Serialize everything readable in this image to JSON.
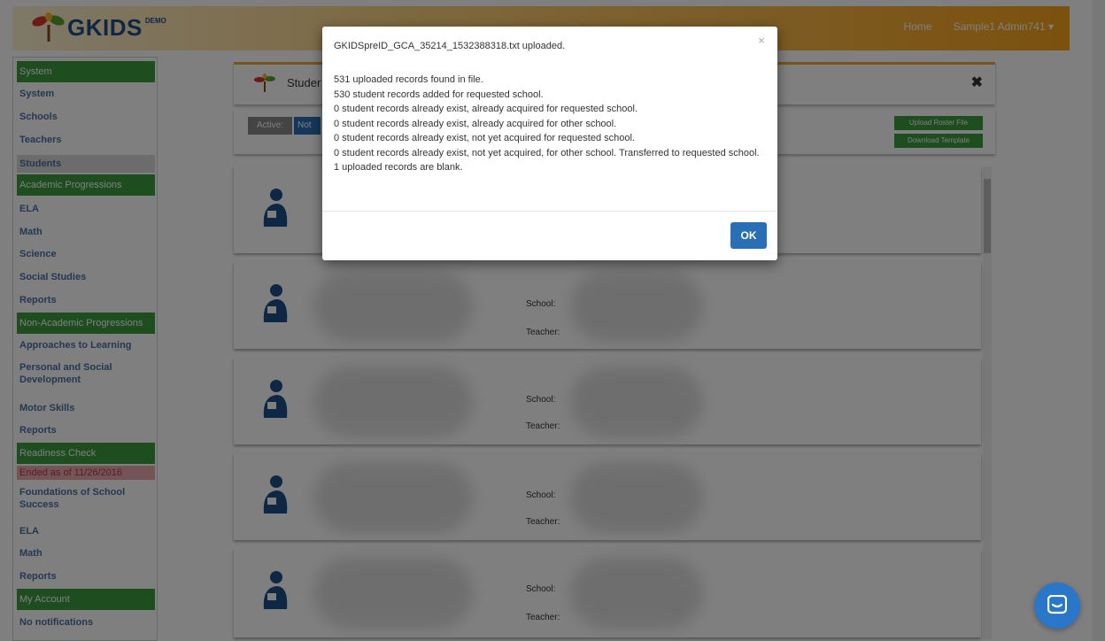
{
  "brand": {
    "name": "GKIDS",
    "badge": "DEMO"
  },
  "nav": {
    "home": "Home",
    "user_menu": "Sample1 Admin741 ▾"
  },
  "sidebar": {
    "items": [
      {
        "label": "System",
        "type": "head"
      },
      {
        "label": "System"
      },
      {
        "label": "Schools"
      },
      {
        "label": "Teachers"
      },
      {
        "label": "Students",
        "active": true
      },
      {
        "label": "Academic Progressions",
        "type": "head"
      },
      {
        "label": "ELA"
      },
      {
        "label": "Math"
      },
      {
        "label": "Science"
      },
      {
        "label": "Social Studies"
      },
      {
        "label": "Reports"
      },
      {
        "label": "Non-Academic Progressions",
        "type": "head"
      },
      {
        "label": "Approaches to Learning"
      },
      {
        "label": "Personal and Social Development"
      },
      {
        "label": "Motor Skills"
      },
      {
        "label": "Reports"
      },
      {
        "label": "Readiness Check",
        "type": "head"
      },
      {
        "label": "Ended as of 11/26/2016",
        "type": "ended"
      },
      {
        "label": "Foundations of School Success"
      },
      {
        "label": "ELA"
      },
      {
        "label": "Math"
      },
      {
        "label": "Reports"
      },
      {
        "label": "My Account",
        "type": "head"
      },
      {
        "label": "No notifications"
      }
    ]
  },
  "main": {
    "header_title": "Studer",
    "close_icon": "✖",
    "toolbar": {
      "active": "Active:",
      "not": "Not",
      "upload": "Upload Roster File",
      "download": "Download Template"
    }
  },
  "students": [
    {
      "school_label": "School:",
      "teacher_label": "Teacher:"
    },
    {
      "school_label": "School:",
      "teacher_label": "Teacher:"
    },
    {
      "school_label": "School:",
      "teacher_label": "Teacher:"
    },
    {
      "school_label": "School:",
      "teacher_label": "Teacher:"
    }
  ],
  "modal": {
    "title": "GKIDSpreID_GCA_35214_1532388318.txt uploaded.",
    "close": "×",
    "lines": [
      "531 uploaded records found in file.",
      "530 student records added for requested school.",
      "0 student records already exist, already acquired for requested school.",
      "0 student records already exist, already acquired for other school.",
      "0 student records already exist, not yet acquired for requested school.",
      "0 student records already exist, not yet acquired, for other school. Transferred to requested school.",
      "1 uploaded records are blank."
    ],
    "ok": "OK"
  },
  "colors": {
    "accent_green": "#3c9a3f",
    "accent_blue": "#2a6fb6",
    "accent_orange": "#f7a21b"
  }
}
